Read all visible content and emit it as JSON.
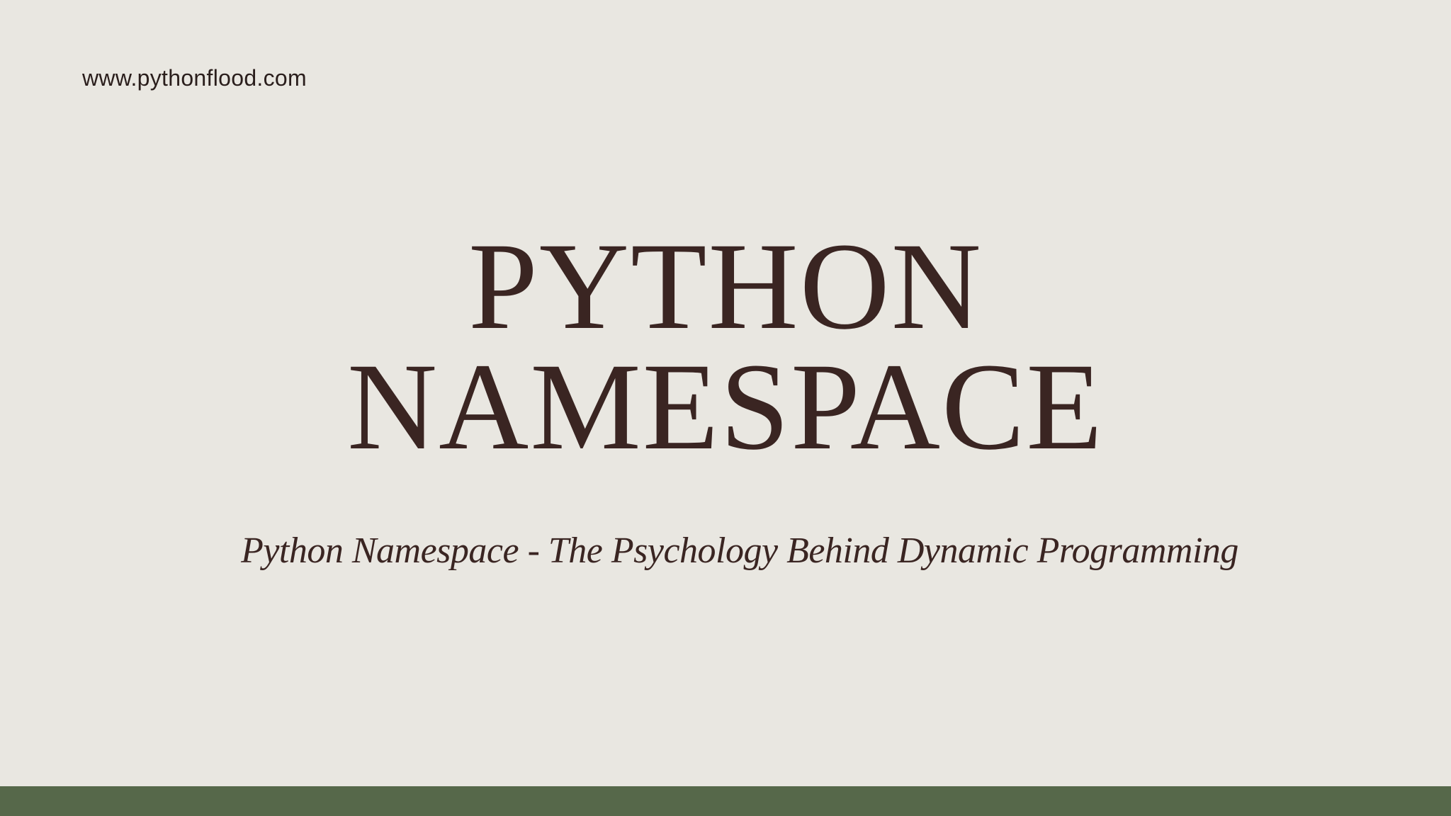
{
  "slide": {
    "website": "www.pythonflood.com",
    "title_line_1": "PYTHON",
    "title_line_2": "NAMESPACE",
    "subtitle": "Python Namespace - The Psychology Behind Dynamic Programming"
  },
  "colors": {
    "background": "#e9e7e1",
    "text": "#3a2522",
    "footer_band": "#56684a"
  }
}
